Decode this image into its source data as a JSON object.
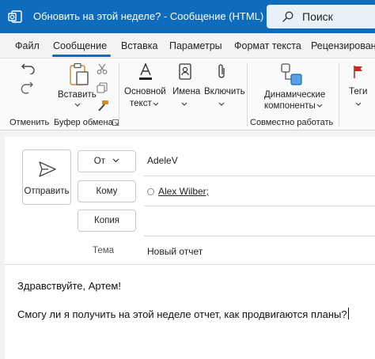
{
  "window": {
    "title": "Обновить на этой неделе? - Сообщение (HTML)"
  },
  "search": {
    "label": "Поиск"
  },
  "tabs": [
    "Файл",
    "Сообщение",
    "Вставка",
    "Параметры",
    "Формат текста",
    "Рецензирован"
  ],
  "active_tab": "Сообщение",
  "ribbon": {
    "groups": {
      "undo": "Отменить",
      "clipboard": "Буфер обмена",
      "collab": "Совместно работать"
    },
    "paste": "Вставить",
    "basic_text": [
      "Основной",
      "текст"
    ],
    "names": "Имена",
    "include": "Включить",
    "dynamic": [
      "Динамические",
      "компоненты"
    ],
    "tags": "Теги"
  },
  "compose": {
    "send": "Отправить",
    "from_label": "От",
    "from_value": "AdeleV",
    "to_label": "Кому",
    "to_value": "Alex Wilber;",
    "cc_label": "Копия",
    "subject_label": "Тема",
    "subject_value": "Новый отчет",
    "body": [
      "Здравствуйте, Артем!",
      "Смогу ли я получить на этой неделе отчет, как продвигаются планы?"
    ]
  },
  "colors": {
    "accent": "#0f6cbd",
    "tags_flag": "#c42b1c"
  }
}
